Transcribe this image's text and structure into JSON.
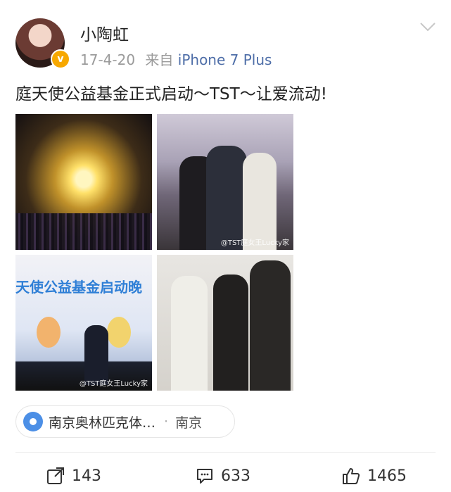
{
  "user": {
    "name": "小陶虹",
    "badge": "v"
  },
  "post": {
    "date": "17-4-20",
    "source_prefix": "来自",
    "device": "iPhone 7 Plus",
    "text": "庭天使公益基金正式启动～TST～让爱流动!"
  },
  "images": {
    "watermark_2": "@TST庭女王Lucky家",
    "banner_3": "天使公益基金启动晚",
    "watermark_3": "@TST庭女王Lucky家"
  },
  "location": {
    "place": "南京奥林匹克体…",
    "separator": "·",
    "city": "南京"
  },
  "actions": {
    "repost_count": "143",
    "comment_count": "633",
    "like_count": "1465"
  },
  "colors": {
    "link": "#4e6ea8",
    "location_pin": "#4c8fe6",
    "verified_badge": "#f7a800"
  }
}
